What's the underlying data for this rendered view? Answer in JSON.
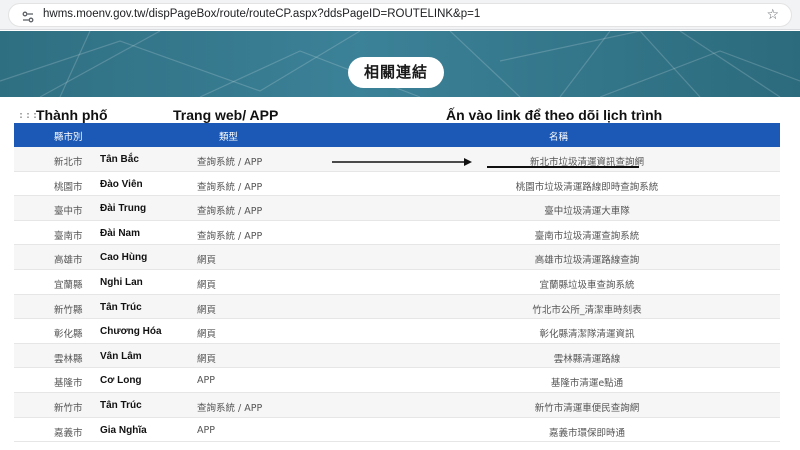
{
  "browser": {
    "url": "hwms.moenv.gov.tw/dispPageBox/route/routeCP.aspx?ddsPageID=ROUTELINK&p=1"
  },
  "banner": {
    "title": "相關連結"
  },
  "annotations": {
    "dots": ":::",
    "city": "Thành phố",
    "type": "Trang web/ APP",
    "link": "Ấn vào link để theo dõi lịch trình"
  },
  "table": {
    "headers": {
      "city": "縣市別",
      "type": "類型",
      "name": "名稱"
    },
    "rows": [
      {
        "city": "新北市",
        "vn": "Tân Bắc",
        "type": "查詢系統 / APP",
        "name": "新北市垃圾清運資訊查詢網"
      },
      {
        "city": "桃園市",
        "vn": "Đào Viên",
        "type": "查詢系統 / APP",
        "name": "桃園市垃圾清運路線即時查詢系統"
      },
      {
        "city": "臺中市",
        "vn": "Đài Trung",
        "type": "查詢系統 / APP",
        "name": "臺中垃圾清運大車隊"
      },
      {
        "city": "臺南市",
        "vn": "Đài Nam",
        "type": "查詢系統 / APP",
        "name": "臺南市垃圾清運查詢系統"
      },
      {
        "city": "高雄市",
        "vn": "Cao Hùng",
        "type": "網頁",
        "name": "高雄市垃圾清運路線查詢"
      },
      {
        "city": "宜蘭縣",
        "vn": "Nghi Lan",
        "type": "網頁",
        "name": "宜蘭縣垃圾車查詢系統"
      },
      {
        "city": "新竹縣",
        "vn": "Tân Trúc",
        "type": "網頁",
        "name": "竹北市公所_清潔車時刻表"
      },
      {
        "city": "彰化縣",
        "vn": "Chương Hóa",
        "type": "網頁",
        "name": "彰化縣清潔隊清運資訊"
      },
      {
        "city": "雲林縣",
        "vn": "Vân Lâm",
        "type": "網頁",
        "name": "雲林縣清運路線"
      },
      {
        "city": "基隆市",
        "vn": "Cơ Long",
        "type": "APP",
        "name": "基隆市清運e點通"
      },
      {
        "city": "新竹市",
        "vn": "Tân Trúc",
        "type": "查詢系統 / APP",
        "name": "新竹市清運車便民查詢網"
      },
      {
        "city": "嘉義市",
        "vn": "Gia Nghĩa",
        "type": "APP",
        "name": "嘉義市環保即時通"
      }
    ]
  },
  "colors": {
    "header_bg": "#1c59b6",
    "banner": "#3b8197"
  },
  "icons": [
    "site-info-icon",
    "star-icon",
    "arrow-icon"
  ]
}
